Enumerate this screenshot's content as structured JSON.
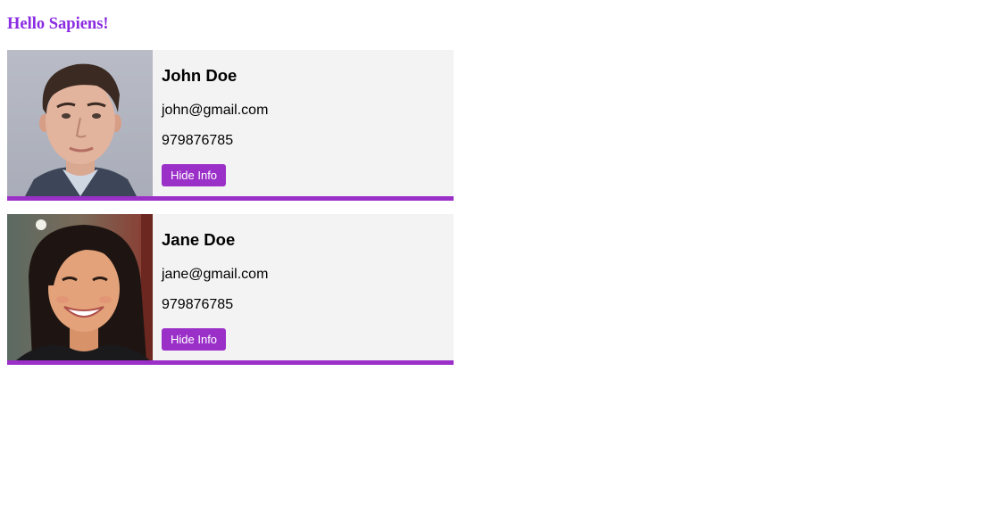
{
  "page": {
    "heading": "Hello Sapiens!",
    "accent_color": "#9b30c9",
    "heading_color": "#8a2be2"
  },
  "contacts": [
    {
      "name": "John Doe",
      "email": "john@gmail.com",
      "phone": "979876785",
      "button_label": "Hide Info",
      "avatar_icon": "man-portrait-photo"
    },
    {
      "name": "Jane Doe",
      "email": "jane@gmail.com",
      "phone": "979876785",
      "button_label": "Hide Info",
      "avatar_icon": "woman-portrait-photo"
    }
  ]
}
